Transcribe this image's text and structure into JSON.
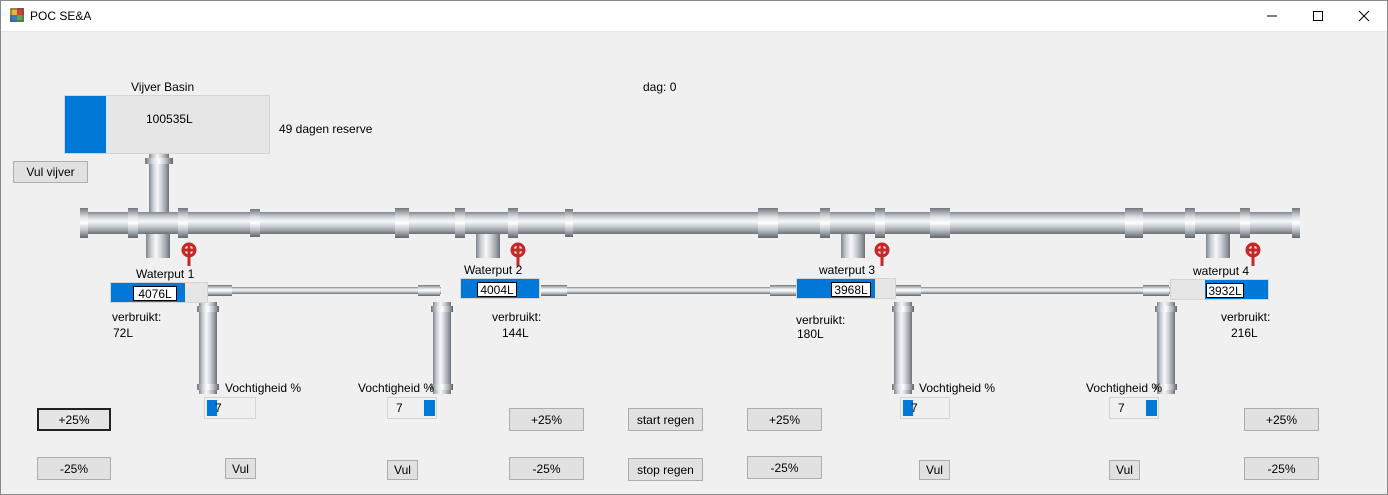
{
  "window": {
    "title": "POC SE&A"
  },
  "basin": {
    "label": "Vijver Basin",
    "value": "100535L",
    "level": 0.2,
    "reserve": "49 dagen reserve",
    "fill_button": "Vul vijver"
  },
  "day": "dag: 0",
  "wells": [
    {
      "label": "Waterput 1",
      "value": "4076L",
      "used_label": "verbruikt:",
      "used": "72L"
    },
    {
      "label": "Waterput 2",
      "value": "4004L",
      "used_label": "verbruikt:",
      "used": "144L"
    },
    {
      "label": "waterput 3",
      "value": "3968L",
      "used_label": "verbruikt:",
      "used": "180L"
    },
    {
      "label": "waterput 4",
      "value": "3932L",
      "used_label": "verbruikt:",
      "used": "216L"
    }
  ],
  "fields": [
    {
      "label": "Vochtigheid %",
      "value": "7",
      "button": "Vul"
    },
    {
      "label": "Vochtigheid %",
      "value": "7",
      "button": "Vul"
    },
    {
      "label": "Vochtigheid %",
      "value": "7",
      "button": "Vul"
    },
    {
      "label": "Vochtigheid %",
      "value": "7",
      "button": "Vul"
    }
  ],
  "controls": {
    "plus": "+25%",
    "minus": "-25%",
    "start_rain": "start regen",
    "stop_rain": "stop regen"
  },
  "colors": {
    "accent": "#0078d7",
    "valve": "#c62828"
  }
}
